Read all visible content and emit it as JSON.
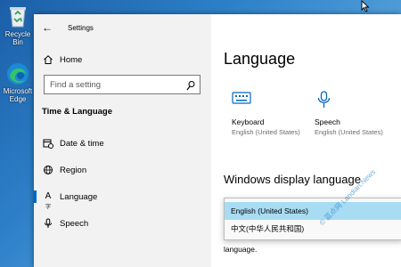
{
  "desktop": {
    "icons": [
      {
        "label": "Recycle Bin"
      },
      {
        "label": "Microsoft Edge"
      }
    ]
  },
  "window": {
    "title": "Settings"
  },
  "sidebar": {
    "home_label": "Home",
    "search_placeholder": "Find a setting",
    "group_heading": "Time & Language",
    "items": [
      {
        "label": "Date & time",
        "icon": "calendar-clock-icon"
      },
      {
        "label": "Region",
        "icon": "globe-icon"
      },
      {
        "label": "Language",
        "icon": "language-icon",
        "selected": true
      },
      {
        "label": "Speech",
        "icon": "microphone-icon"
      }
    ]
  },
  "main": {
    "page_title": "Language",
    "tiles": [
      {
        "name": "Keyboard",
        "sub": "English (United States)",
        "icon": "keyboard-icon"
      },
      {
        "name": "Speech",
        "sub": "English (United States)",
        "icon": "microphone-icon"
      }
    ],
    "display_language": {
      "heading": "Windows display language",
      "options": [
        "English (United States)",
        "中文(中华人民共和国)"
      ],
      "selected_index": 0
    },
    "obscured_text": "language."
  },
  "watermark": "© 蓝点网 Landian.News",
  "colors": {
    "accent": "#0067c0",
    "selected_option": "#a8dcf3",
    "sidebar_bg": "#f2f2f2"
  }
}
